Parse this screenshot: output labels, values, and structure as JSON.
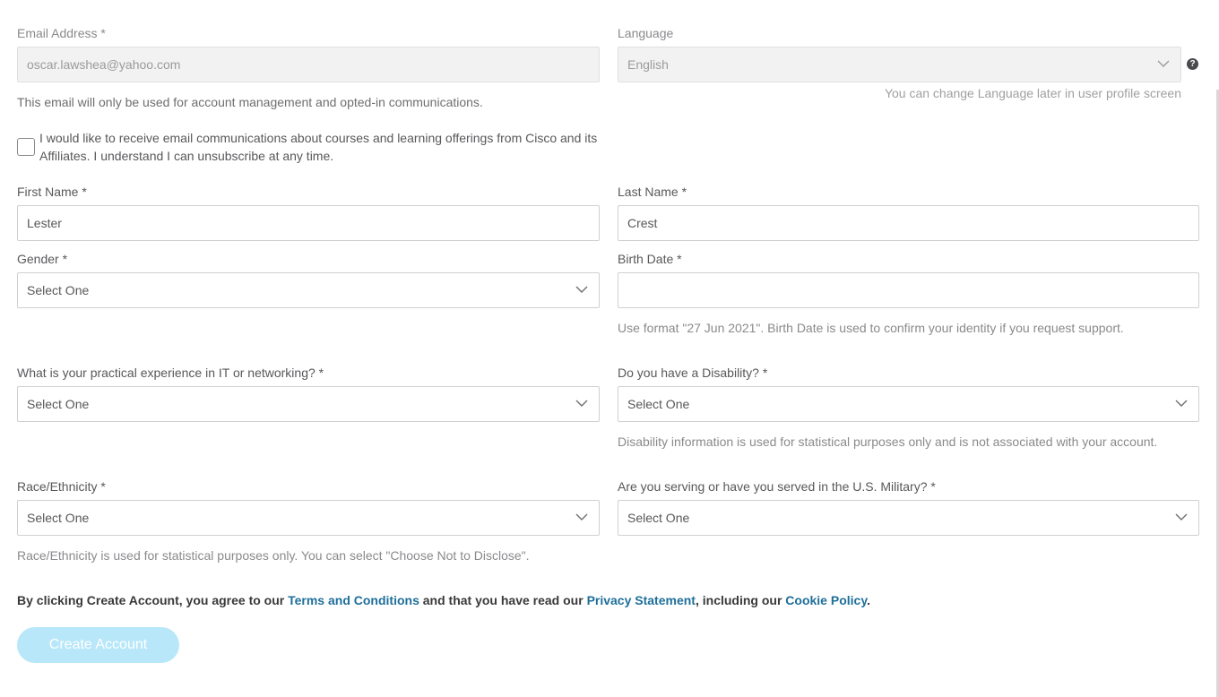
{
  "email": {
    "label": "Email Address *",
    "value": "oscar.lawshea@yahoo.com",
    "hint": "This email will only be used for account management and opted-in communications."
  },
  "language": {
    "label": "Language",
    "value": "English",
    "hint": "You can change Language later in user profile screen",
    "help_glyph": "?"
  },
  "consent": {
    "text": "I would like to receive email communications about courses and learning offerings from Cisco and its Affiliates. I understand I can unsubscribe at any time."
  },
  "first_name": {
    "label": "First Name *",
    "value": "Lester"
  },
  "last_name": {
    "label": "Last Name *",
    "value": "Crest"
  },
  "gender": {
    "label": "Gender *",
    "value": "Select One"
  },
  "birth_date": {
    "label": "Birth Date *",
    "value": "",
    "hint": "Use format \"27 Jun 2021\". Birth Date is used to confirm your identity if you request support."
  },
  "experience": {
    "label": "What is your practical experience in IT or networking? *",
    "value": "Select One"
  },
  "disability": {
    "label": "Do you have a Disability? *",
    "value": "Select One",
    "hint": "Disability information is used for statistical purposes only and is not associated with your account."
  },
  "race": {
    "label": "Race/Ethnicity *",
    "value": "Select One",
    "hint": "Race/Ethnicity is used for statistical purposes only. You can select \"Choose Not to Disclose\"."
  },
  "military": {
    "label": "Are you serving or have you served in the U.S. Military? *",
    "value": "Select One"
  },
  "agreement": {
    "prefix": "By clicking Create Account, you agree to our ",
    "terms": "Terms and Conditions",
    "middle": " and that you have read our ",
    "privacy": "Privacy Statement",
    "middle2": ", including our ",
    "cookie": "Cookie Policy",
    "suffix": "."
  },
  "create_button": "Create Account",
  "colors": {
    "link": "#1e6f9a",
    "button_disabled": "#b8e7fa"
  }
}
